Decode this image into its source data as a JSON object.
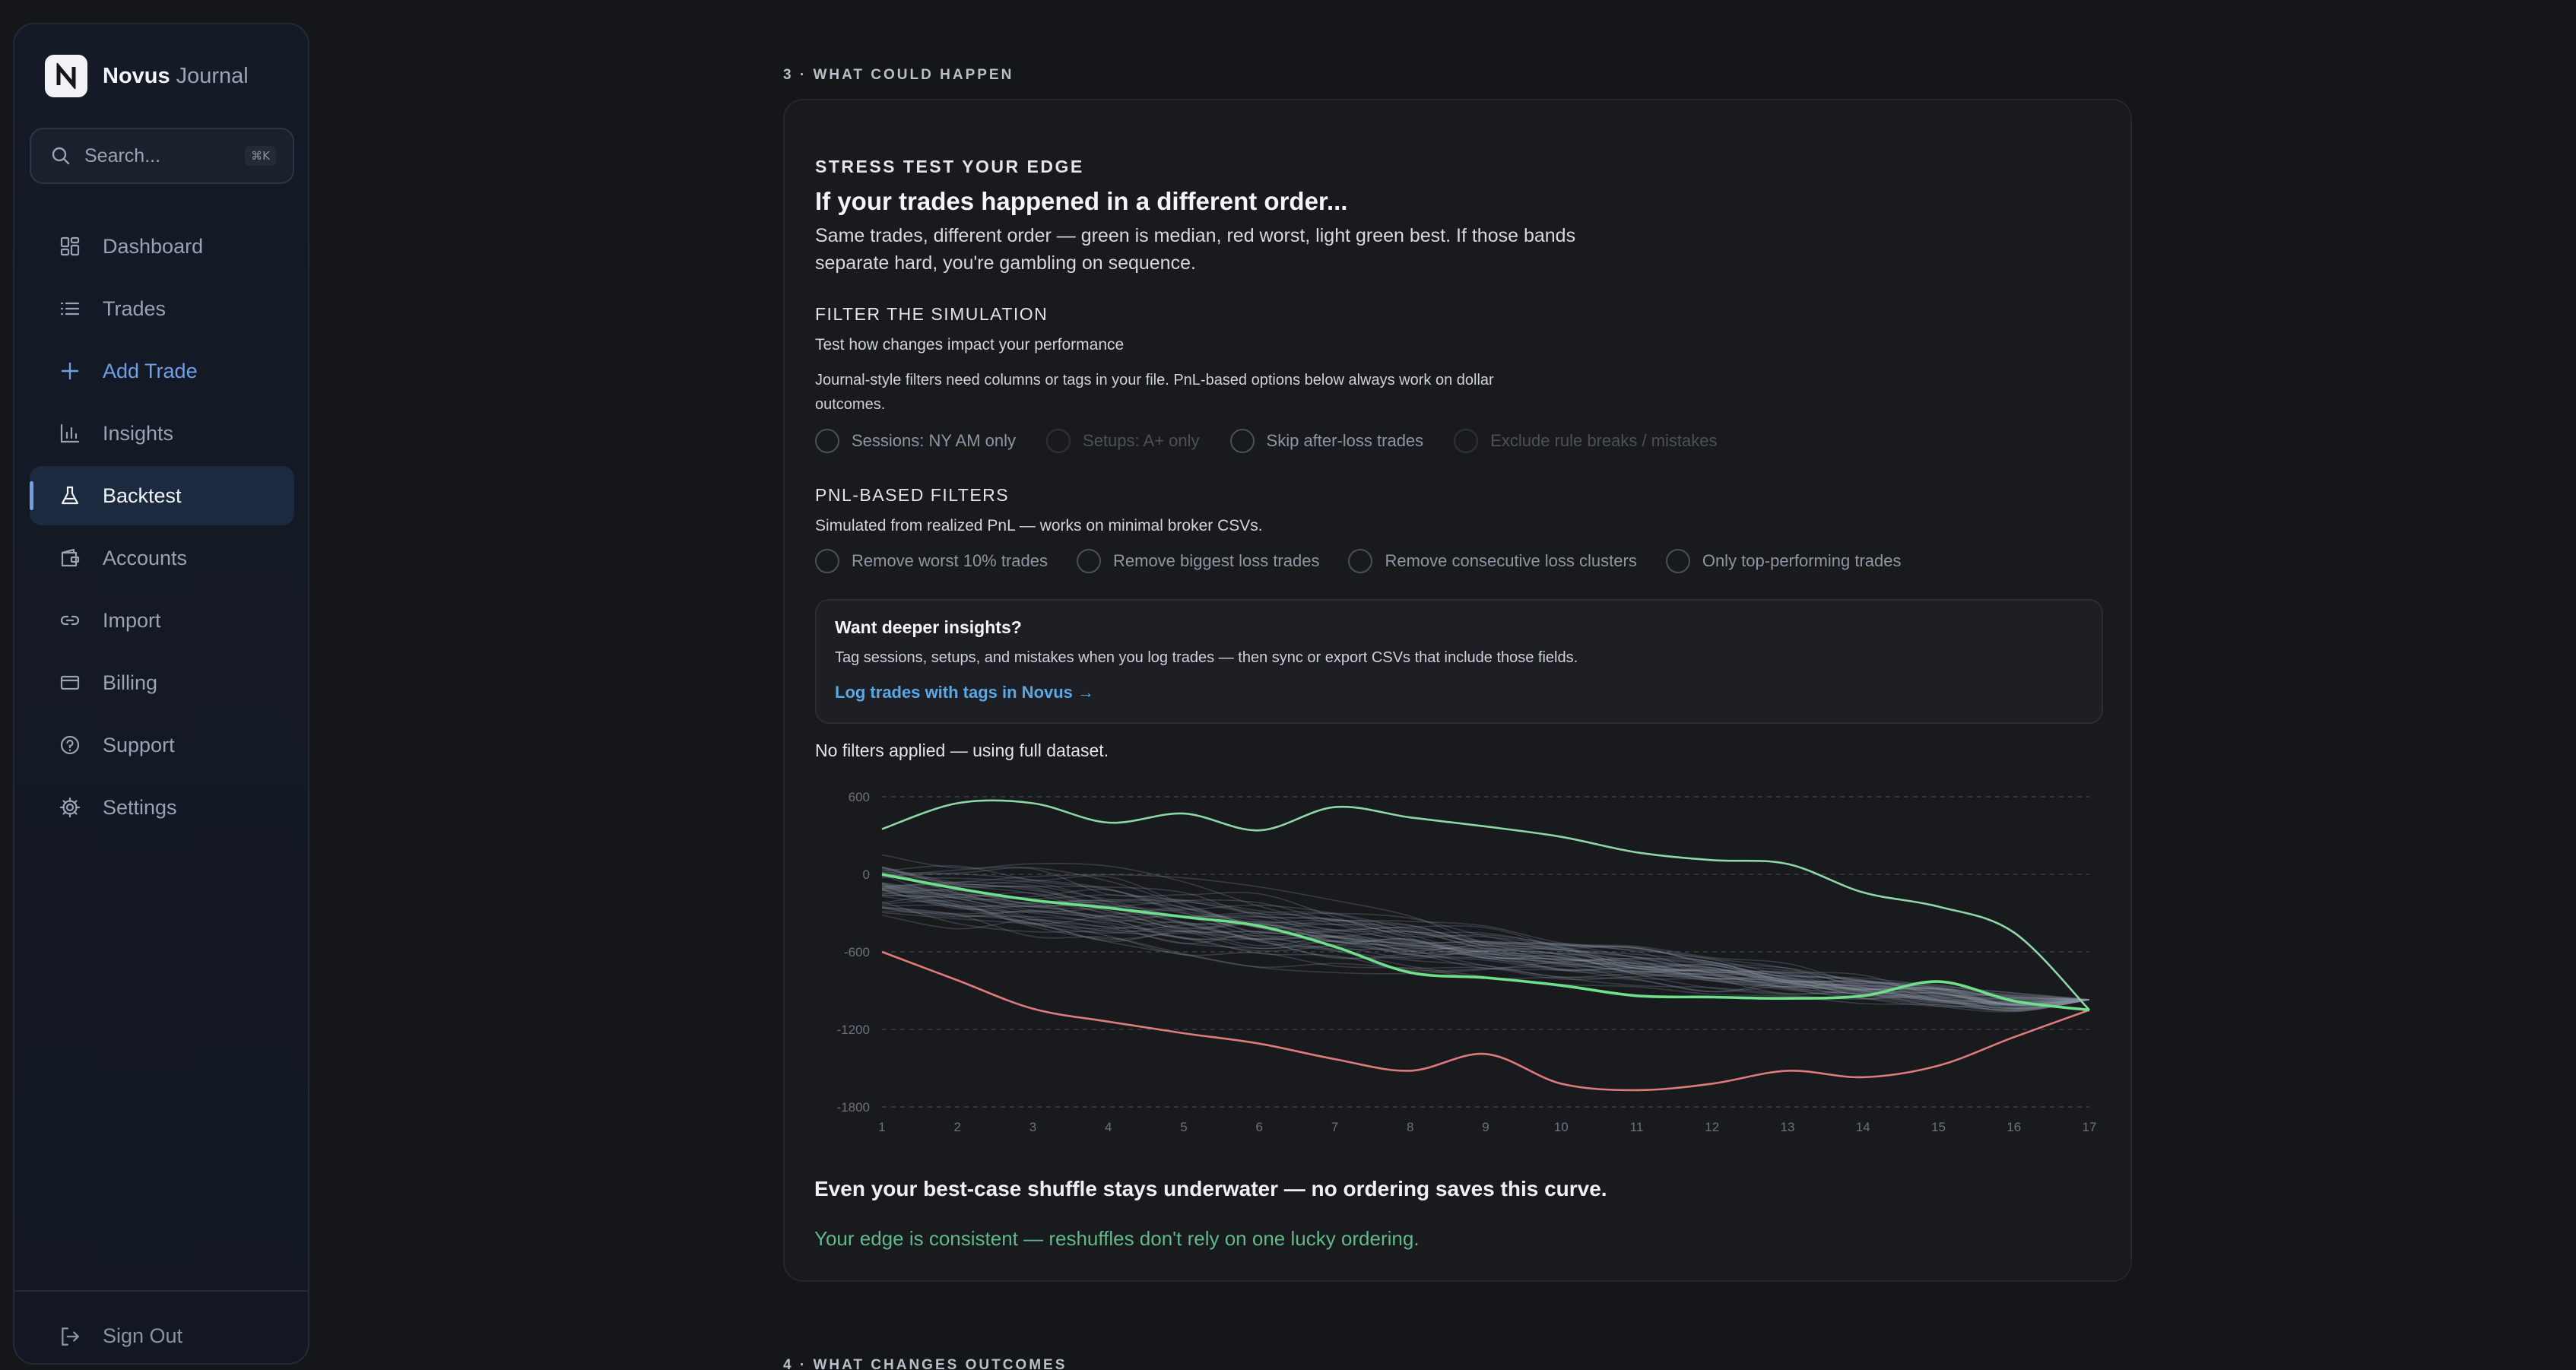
{
  "brand": {
    "name": "Novus",
    "sub": "Journal"
  },
  "search": {
    "placeholder": "Search...",
    "shortcut": "⌘K"
  },
  "nav": [
    {
      "label": "Dashboard",
      "icon": "dashboard-icon"
    },
    {
      "label": "Trades",
      "icon": "list-icon"
    },
    {
      "label": "Add Trade",
      "icon": "plus-icon"
    },
    {
      "label": "Insights",
      "icon": "bar-chart-icon"
    },
    {
      "label": "Backtest",
      "icon": "flask-icon"
    },
    {
      "label": "Accounts",
      "icon": "wallet-icon"
    },
    {
      "label": "Import",
      "icon": "link-icon"
    },
    {
      "label": "Billing",
      "icon": "credit-card-icon"
    },
    {
      "label": "Support",
      "icon": "help-circle-icon"
    },
    {
      "label": "Settings",
      "icon": "gear-icon"
    }
  ],
  "signout": {
    "label": "Sign Out"
  },
  "sections": {
    "current": "3 · WHAT COULD HAPPEN",
    "next": "4 · WHAT CHANGES OUTCOMES"
  },
  "card": {
    "eyebrow": "STRESS TEST YOUR EDGE",
    "headline": "If your trades happened in a different order...",
    "description_line1": "Same trades, different order — green is median, red worst, light green best. If those bands",
    "description_line2": "separate hard, you're gambling on sequence.",
    "filter_title": "FILTER THE SIMULATION",
    "filter_sub": "Test how changes impact your performance",
    "journal_note_line1": "Journal-style filters need columns or tags in your file. PnL-based options below always work on dollar",
    "journal_note_line2": "outcomes.",
    "journal_options": [
      {
        "label": "Sessions: NY AM only",
        "enabled": true
      },
      {
        "label": "Setups: A+ only",
        "enabled": false
      },
      {
        "label": "Skip after-loss trades",
        "enabled": true
      },
      {
        "label": "Exclude rule breaks / mistakes",
        "enabled": false
      }
    ],
    "pnl_title": "PNL-BASED FILTERS",
    "pnl_sub": "Simulated from realized PnL — works on minimal broker CSVs.",
    "pnl_options": [
      {
        "label": "Remove worst 10% trades"
      },
      {
        "label": "Remove biggest loss trades"
      },
      {
        "label": "Remove consecutive loss clusters"
      },
      {
        "label": "Only top-performing trades"
      }
    ],
    "callout": {
      "title": "Want deeper insights?",
      "text": "Tag sessions, setups, and mistakes when you log trades — then sync or export CSVs that include those fields.",
      "link": "Log trades with tags in Novus →"
    },
    "filter_status": "No filters applied — using full dataset.",
    "verdict": "Even your best-case shuffle stays underwater — no ordering saves this curve.",
    "verdict_green": "Your edge is consistent — reshuffles don't rely on one lucky ordering."
  },
  "colors": {
    "best": "#8fd6a6",
    "median": "#6fe08a",
    "worst": "#e07b7b",
    "paths": "#8a93a3",
    "accent": "#6f9fe6",
    "link": "#5aa9e6"
  },
  "chart_data": {
    "type": "line",
    "x": [
      1,
      2,
      3,
      4,
      5,
      6,
      7,
      8,
      9,
      10,
      11,
      12,
      13,
      14,
      15,
      16,
      17
    ],
    "y_ticks": [
      600,
      0,
      -600,
      -1200,
      -1800
    ],
    "ylim": [
      -1800,
      600
    ],
    "grid": true,
    "series": [
      {
        "role": "best",
        "values": [
          350,
          550,
          550,
          400,
          470,
          340,
          520,
          440,
          370,
          290,
          170,
          110,
          80,
          -140,
          -250,
          -450,
          -1050
        ]
      },
      {
        "role": "median",
        "values": [
          0,
          -110,
          -200,
          -260,
          -330,
          -400,
          -560,
          -760,
          -800,
          -860,
          -940,
          -950,
          -960,
          -940,
          -830,
          -980,
          -1050
        ]
      },
      {
        "role": "worst",
        "values": [
          -600,
          -820,
          -1040,
          -1140,
          -1230,
          -1310,
          -1430,
          -1520,
          -1390,
          -1620,
          -1670,
          -1620,
          -1520,
          -1570,
          -1480,
          -1260,
          -1050
        ]
      }
    ]
  }
}
